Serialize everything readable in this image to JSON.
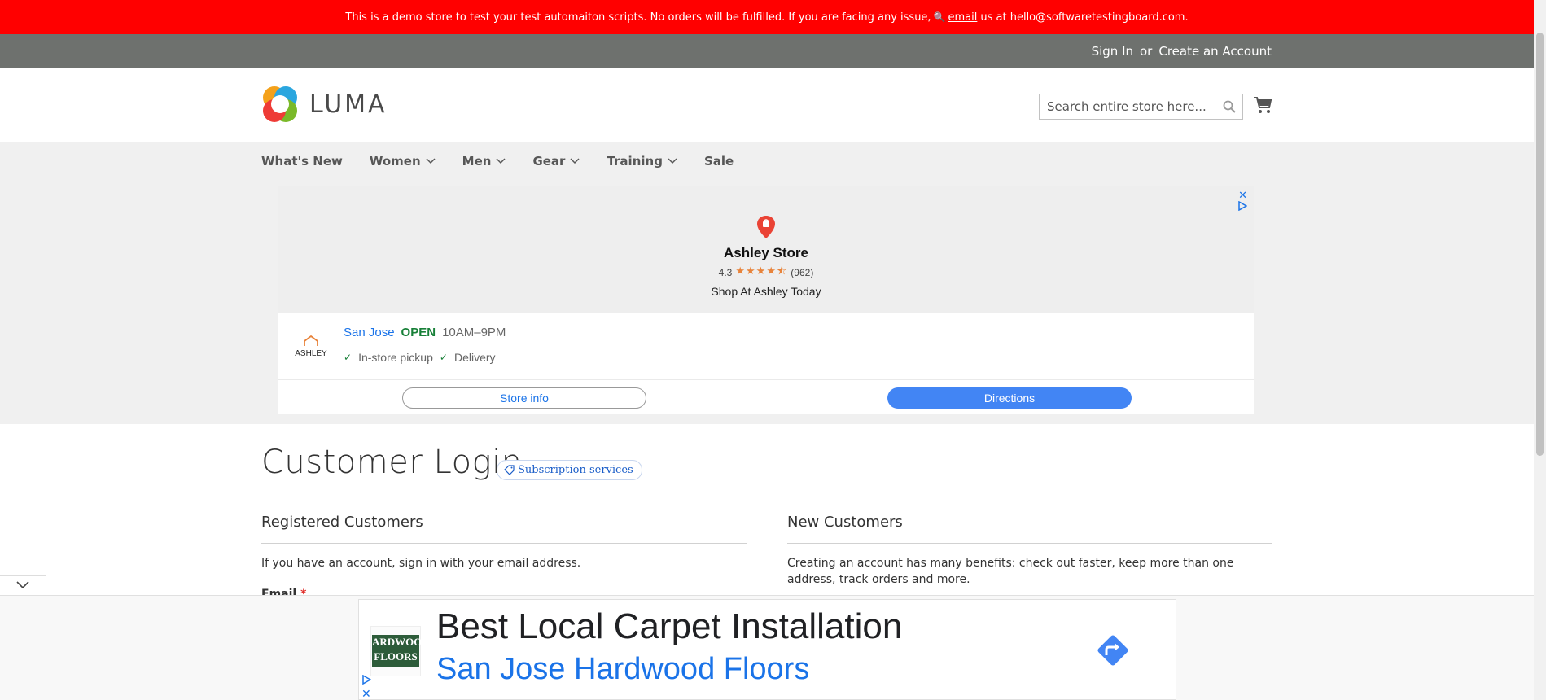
{
  "demo_notice": {
    "text_before": "This is a demo store to test your test automaiton scripts. No orders will be fulfilled. If you are facing any issue,",
    "email_link": "email",
    "text_after": "us at hello@softwaretestingboard.com."
  },
  "header": {
    "sign_in": "Sign In",
    "or": "or",
    "create_account": "Create an Account"
  },
  "logo": {
    "text": "LUMA"
  },
  "search": {
    "placeholder": "Search entire store here..."
  },
  "nav": {
    "items": [
      {
        "label": "What's New",
        "dropdown": false
      },
      {
        "label": "Women",
        "dropdown": true
      },
      {
        "label": "Men",
        "dropdown": true
      },
      {
        "label": "Gear",
        "dropdown": true
      },
      {
        "label": "Training",
        "dropdown": true
      },
      {
        "label": "Sale",
        "dropdown": false
      }
    ]
  },
  "ad_store": {
    "close": "✕",
    "name": "Ashley Store",
    "rating": "4.3",
    "stars": "★★★★⯪",
    "reviews": "(962)",
    "tagline": "Shop At Ashley Today",
    "logo_text": "ASHLEY",
    "city": "San Jose",
    "status": "OPEN",
    "hours": "10AM–9PM",
    "feature_1": "In-store pickup",
    "feature_2": "Delivery",
    "btn_store_info": "Store info",
    "btn_directions": "Directions"
  },
  "page": {
    "title": "Customer Login",
    "badge": "Subscription services"
  },
  "registered": {
    "title": "Registered Customers",
    "text": "If you have an account, sign in with your email address.",
    "email_label": "Email",
    "required_mark": "*"
  },
  "new_customers": {
    "title": "New Customers",
    "text": "Creating an account has many benefits: check out faster, keep more than one address, track orders and more."
  },
  "ad_banner": {
    "headline": "Best Local Carpet Installation",
    "advertiser": "San Jose Hardwood Floors",
    "logo_text": "ARDWOO FLOORS",
    "close": "✕"
  },
  "colors": {
    "notice_bg": "#ff0000",
    "header_bg": "#6e716e",
    "nav_bg": "#f0f0f0",
    "link_blue": "#1a73e8",
    "open_green": "#188038"
  }
}
